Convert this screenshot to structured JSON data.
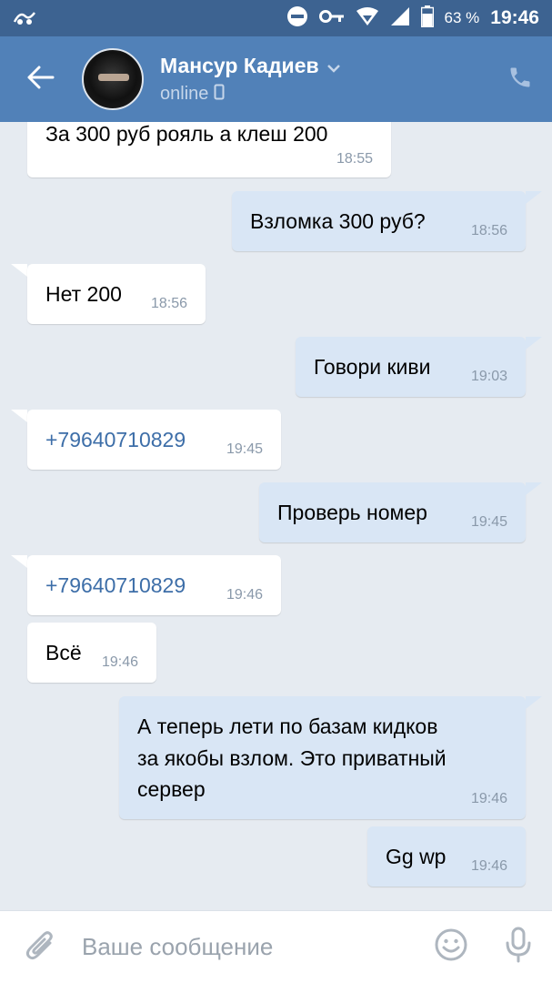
{
  "status_bar": {
    "battery": "63 %",
    "time": "19:46"
  },
  "header": {
    "name": "Мансур Кадиев",
    "status": "online"
  },
  "messages": [
    {
      "dir": "in",
      "text": "За 300 руб рояль а клеш 200",
      "time": "18:55"
    },
    {
      "dir": "out",
      "text": "Взломка 300 руб?",
      "time": "18:56"
    },
    {
      "dir": "in",
      "text": "Нет 200",
      "time": "18:56"
    },
    {
      "dir": "out",
      "text": "Говори киви",
      "time": "19:03"
    },
    {
      "dir": "in",
      "text": "+79640710829",
      "time": "19:45"
    },
    {
      "dir": "out",
      "text": "Проверь номер",
      "time": "19:45"
    },
    {
      "dir": "in",
      "text": "+79640710829",
      "time": "19:46"
    },
    {
      "dir": "in",
      "text": "Всё",
      "time": "19:46"
    },
    {
      "dir": "out",
      "lines": [
        "А теперь лети по базам кидков",
        "за якобы взлом. Это приватный",
        "сервер"
      ],
      "time": "19:46"
    },
    {
      "dir": "out",
      "text": "Gg wp",
      "time": "19:46"
    }
  ],
  "composer": {
    "placeholder": "Ваше сообщение"
  },
  "colors": {
    "status_bar": "#3d6391",
    "header": "#5181b8",
    "chat_background": "#e6ebf1",
    "incoming_bubble": "#ffffff",
    "outgoing_bubble": "#d9e6f5",
    "link": "#3d6ea8"
  },
  "icons": {
    "status_left": "notification-icon",
    "status_right": [
      "do-not-disturb-icon",
      "key-icon",
      "wifi-icon",
      "signal-icon",
      "battery-icon"
    ],
    "header": [
      "back-arrow-icon",
      "chevron-down-icon",
      "mobile-icon",
      "phone-icon"
    ],
    "composer": [
      "paperclip-icon",
      "emoji-icon",
      "microphone-icon"
    ]
  }
}
